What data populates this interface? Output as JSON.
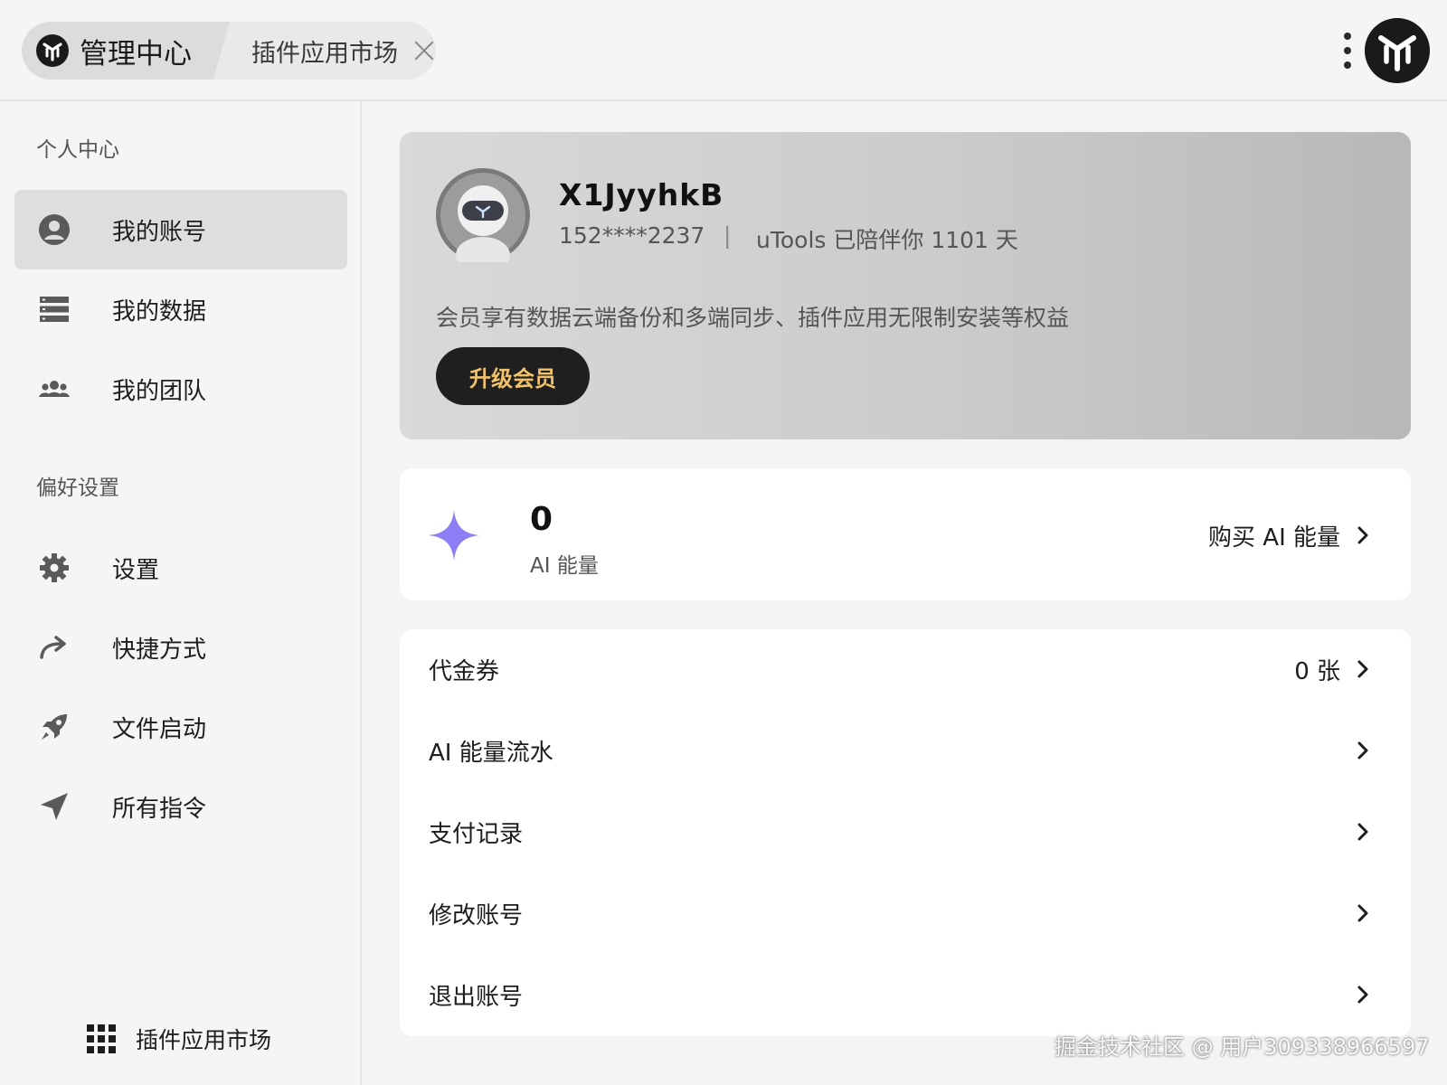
{
  "header": {
    "tabs": [
      {
        "label": "管理中心",
        "active": true,
        "icon": "utools-logo-icon"
      },
      {
        "label": "插件应用市场",
        "active": false,
        "close_icon": "close-icon"
      }
    ],
    "more_icon": "kebab-menu-icon",
    "app_logo": "utools-logo-icon"
  },
  "sidebar": {
    "section_personal": "个人中心",
    "personal_items": [
      {
        "label": "我的账号",
        "icon": "user-circle-icon",
        "active": true
      },
      {
        "label": "我的数据",
        "icon": "database-list-icon",
        "active": false
      },
      {
        "label": "我的团队",
        "icon": "team-icon",
        "active": false
      }
    ],
    "section_prefs": "偏好设置",
    "pref_items": [
      {
        "label": "设置",
        "icon": "gear-icon"
      },
      {
        "label": "快捷方式",
        "icon": "share-arrow-icon"
      },
      {
        "label": "文件启动",
        "icon": "rocket-icon"
      },
      {
        "label": "所有指令",
        "icon": "send-arrow-icon"
      }
    ],
    "market_label": "插件应用市场",
    "market_icon": "grid-icon"
  },
  "profile": {
    "username": "X1JyyhkB",
    "phone": "152****2237",
    "separator": "|",
    "companion_text": "uTools 已陪伴你 1101 天",
    "benefit_text": "会员享有数据云端备份和多端同步、插件应用无限制安装等权益",
    "upgrade_label": "升级会员",
    "avatar_icon": "robot-avatar-icon"
  },
  "ai_energy": {
    "value": "0",
    "label": "AI 能量",
    "buy_label": "购买 AI 能量",
    "icon": "sparkle-icon"
  },
  "account_list": [
    {
      "label": "代金券",
      "value": "0 张"
    },
    {
      "label": "AI 能量流水",
      "value": ""
    },
    {
      "label": "支付记录",
      "value": ""
    },
    {
      "label": "修改账号",
      "value": ""
    },
    {
      "label": "退出账号",
      "value": ""
    }
  ],
  "watermark": "掘金技术社区 @ 用户309338966597",
  "colors": {
    "upgrade_text": "#f2c26a",
    "sparkle": "#8c7ef5",
    "active_nav_bg": "#dedede"
  }
}
